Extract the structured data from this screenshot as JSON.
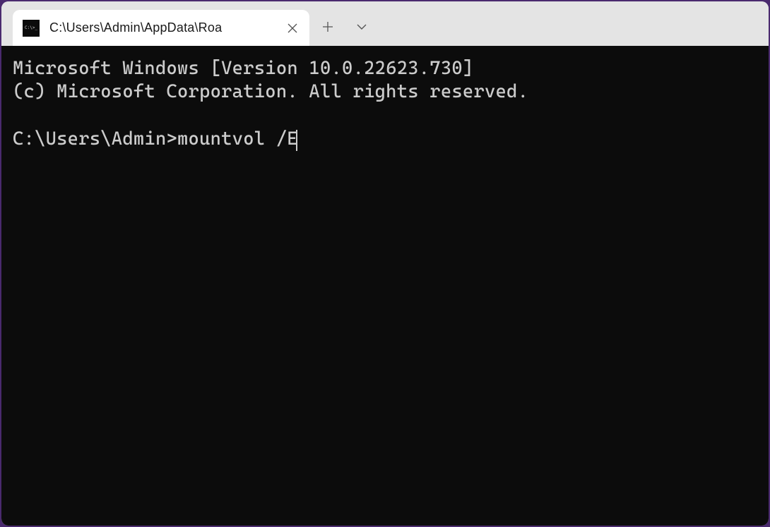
{
  "window": {
    "tab": {
      "title": "C:\\Users\\Admin\\AppData\\Roa",
      "icon_glyph": "C:\\>_"
    }
  },
  "terminal": {
    "banner_line1": "Microsoft Windows [Version 10.0.22623.730]",
    "banner_line2": "(c) Microsoft Corporation. All rights reserved.",
    "prompt": "C:\\Users\\Admin>",
    "command": "mountvol /E"
  },
  "colors": {
    "window_border": "#4a2a6e",
    "titlebar_bg": "#e4e4e4",
    "tab_bg": "#ffffff",
    "terminal_bg": "#0c0c0c",
    "terminal_fg": "#cccccc"
  }
}
